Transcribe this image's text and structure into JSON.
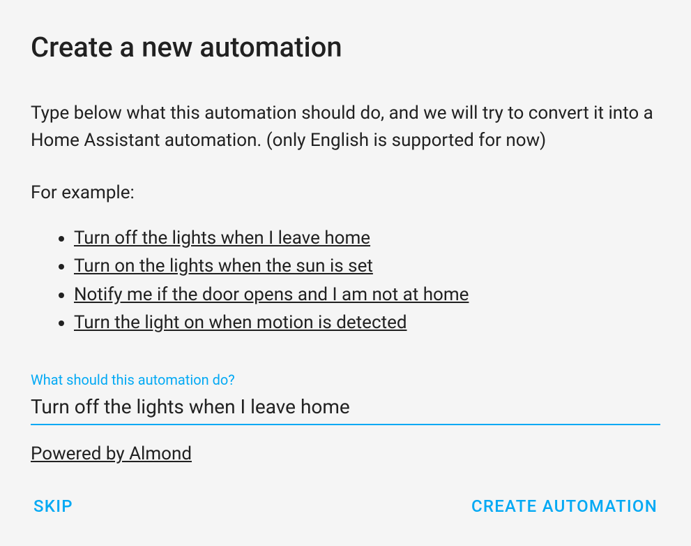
{
  "title": "Create a new automation",
  "description": "Type below what this automation should do, and we will try to convert it into a Home Assistant automation. (only English is supported for now)",
  "examples_label": "For example:",
  "examples": [
    "Turn off the lights when I leave home",
    "Turn on the lights when the sun is set",
    "Notify me if the door opens and I am not at home",
    "Turn the light on when motion is detected"
  ],
  "input_label": "What should this automation do?",
  "input_value": "Turn off the lights when I leave home",
  "powered_by": "Powered by Almond",
  "buttons": {
    "skip": "SKIP",
    "create": "CREATE AUTOMATION"
  }
}
